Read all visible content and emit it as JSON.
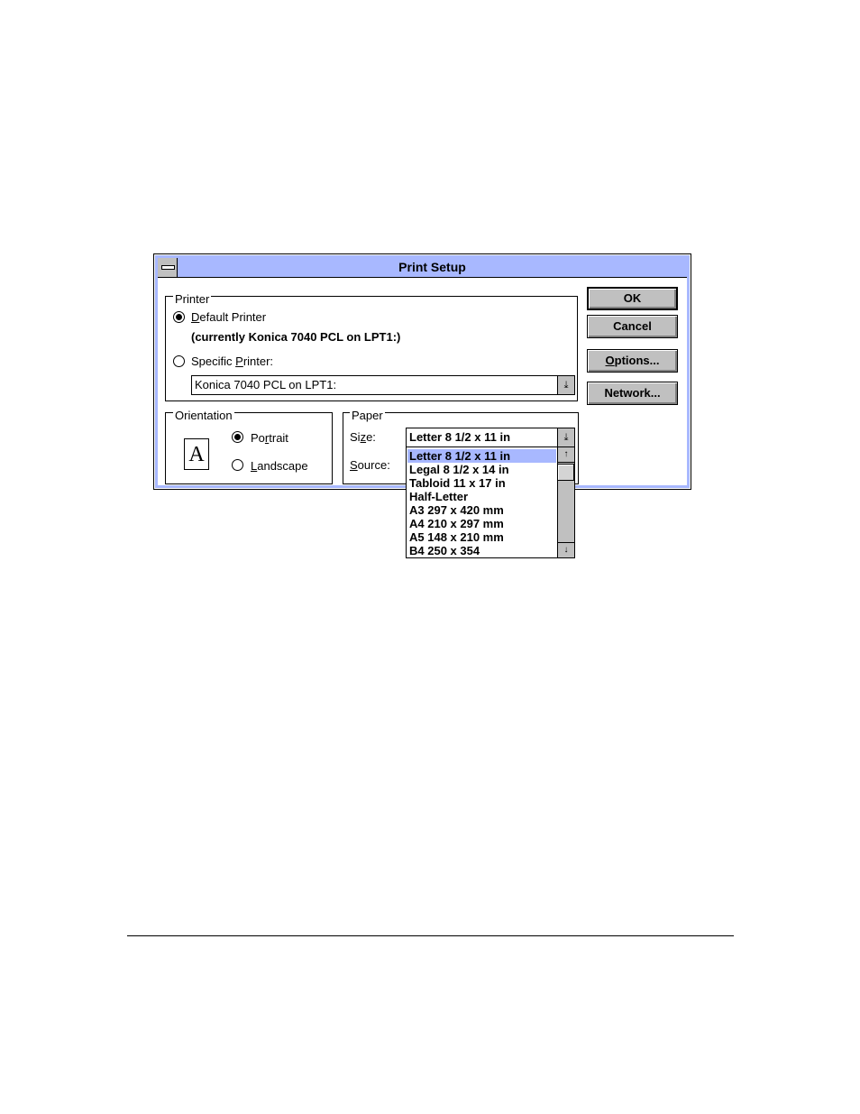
{
  "dialog": {
    "title": "Print Setup"
  },
  "printer_group": {
    "legend": "Printer",
    "default_printer": {
      "label_prefix": "",
      "label_u": "D",
      "label_rest": "efault Printer",
      "selected": true
    },
    "current_note": "(currently Konica 7040 PCL on LPT1:)",
    "specific_printer": {
      "label_pre": "Specific ",
      "label_u": "P",
      "label_rest": "rinter:",
      "selected": false
    },
    "printer_select_value": "Konica 7040 PCL on LPT1:"
  },
  "orientation_group": {
    "legend": "Orientation",
    "icon_letter": "A",
    "portrait": {
      "label_pre": "Po",
      "label_u": "r",
      "label_rest": "trait",
      "selected": true
    },
    "landscape": {
      "label_u": "L",
      "label_rest": "andscape",
      "selected": false
    }
  },
  "paper_group": {
    "legend": "Paper",
    "size_label_pre": "Si",
    "size_label_u": "z",
    "size_label_rest": "e:",
    "size_value": "Letter 8 1/2 x 11 in",
    "source_label_u": "S",
    "source_label_rest": "ource:",
    "size_options": [
      "Letter 8 1/2 x 11 in",
      "Legal 8 1/2 x 14 in",
      "Tabloid 11 x 17 in",
      "Half-Letter",
      "A3 297 x 420 mm",
      "A4 210 x 297 mm",
      "A5 148 x 210 mm",
      "B4 250 x 354"
    ],
    "selected_option_index": 0
  },
  "buttons": {
    "ok": "OK",
    "cancel": "Cancel",
    "options_u": "O",
    "options_rest": "ptions...",
    "network": "Network..."
  },
  "icons": {
    "system_menu": "system-menu-icon",
    "dropdown_arrow": "dropdown-arrow-icon",
    "scroll_up": "scroll-up-arrow-icon",
    "scroll_down": "scroll-down-arrow-icon",
    "portrait_page": "portrait-page-icon"
  },
  "colors": {
    "titlebar": "#a8b8ff",
    "selection": "#a8b8ff",
    "button_face": "#c0c0c0"
  }
}
